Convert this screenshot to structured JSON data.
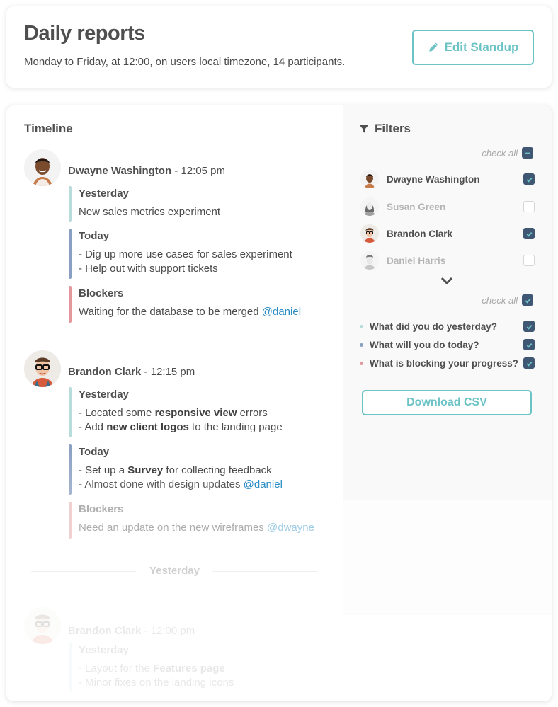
{
  "header": {
    "title": "Daily reports",
    "subtitle": "Monday to Friday, at 12:00, on users local timezone, 14 participants.",
    "edit_button_label": "Edit Standup",
    "edit_button_icon": "pencil-icon"
  },
  "colors": {
    "accent": "#6cc3c6",
    "checkbox_on": "#405773",
    "yesterday": "#b8dcdc",
    "today": "#8aa0c2",
    "blockers": "#e2989c",
    "mention": "#2c8dc4"
  },
  "timeline": {
    "title": "Timeline",
    "entries": [
      {
        "name": "Dwayne Washington",
        "time": " - 12:05 pm",
        "sections": [
          {
            "label": "Yesterday",
            "lines": [
              "New sales metrics experiment"
            ]
          },
          {
            "label": "Today",
            "lines": [
              "- Dig up more use cases for sales experiment",
              "- Help out with support tickets"
            ]
          },
          {
            "label": "Blockers",
            "text": "Waiting for the database to be merged ",
            "mention": "@daniel"
          }
        ]
      },
      {
        "name": "Brandon Clark",
        "time": " - 12:15 pm",
        "sections": [
          {
            "label": "Yesterday",
            "line1_pre": "- Located some ",
            "line1_bold": "responsive view",
            "line1_post": " errors",
            "line2_pre": "- Add ",
            "line2_bold": "new client logos",
            "line2_post": " to the landing page"
          },
          {
            "label": "Today",
            "line1_pre": "- Set up a ",
            "line1_bold": "Survey",
            "line1_post": " for collecting feedback",
            "line2_pre": "- Almost done with design updates ",
            "line2_mention": "@daniel"
          },
          {
            "label": "Blockers",
            "text": "Need an update on the new wireframes ",
            "mention": "@dwayne"
          }
        ]
      }
    ],
    "day_divider": "Yesterday",
    "older_entry": {
      "name": "Brandon Clark",
      "time": " - 12:00 pm",
      "section_label": "Yesterday",
      "line1_pre": "- Layout for the ",
      "line1_bold": "Features page",
      "line2": "- Minor fixes on the landing icons"
    }
  },
  "filters": {
    "title": "Filters",
    "people_check_all_label": "check all",
    "people_check_all_state": "indeterminate",
    "people": [
      {
        "name": "Dwayne Washington",
        "checked": true
      },
      {
        "name": "Susan Green",
        "checked": false
      },
      {
        "name": "Brandon Clark",
        "checked": true
      },
      {
        "name": "Daniel Harris",
        "checked": false
      }
    ],
    "expand_icon": "chevron-down-icon",
    "questions_check_all_label": "check all",
    "questions_check_all_state": "checked",
    "questions": [
      {
        "text": "What did you do yesterday?",
        "checked": true
      },
      {
        "text": "What will you do today?",
        "checked": true
      },
      {
        "text": "What is blocking your progress?",
        "checked": true
      }
    ],
    "download_button_label": "Download CSV"
  }
}
